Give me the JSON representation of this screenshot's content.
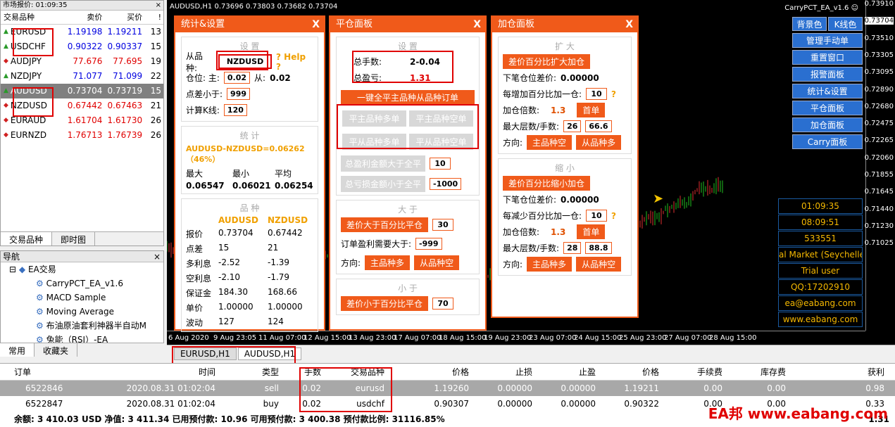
{
  "market": {
    "caption": "市场报价: 01:09:35",
    "close": "×",
    "headers": [
      "交易品种",
      "卖价",
      "买价",
      "!"
    ],
    "rows": [
      {
        "sym": "EURUSD",
        "bid": "1.19198",
        "ask": "1.19211",
        "sp": "13",
        "dir": "up",
        "bc": "blue",
        "ac": "blue"
      },
      {
        "sym": "USDCHF",
        "bid": "0.90322",
        "ask": "0.90337",
        "sp": "15",
        "dir": "up",
        "bc": "blue",
        "ac": "blue"
      },
      {
        "sym": "AUDJPY",
        "bid": "77.676",
        "ask": "77.695",
        "sp": "19",
        "dir": "dn",
        "bc": "red",
        "ac": "red"
      },
      {
        "sym": "NZDJPY",
        "bid": "71.077",
        "ask": "71.099",
        "sp": "22",
        "dir": "up",
        "bc": "blue",
        "ac": "blue"
      },
      {
        "sym": "AUDUSD",
        "bid": "0.73704",
        "ask": "0.73719",
        "sp": "15",
        "dir": "up",
        "bc": "red",
        "ac": "red",
        "sel": true
      },
      {
        "sym": "NZDUSD",
        "bid": "0.67442",
        "ask": "0.67463",
        "sp": "21",
        "dir": "dn",
        "bc": "red",
        "ac": "red"
      },
      {
        "sym": "EURAUD",
        "bid": "1.61704",
        "ask": "1.61730",
        "sp": "26",
        "dir": "dn",
        "bc": "red",
        "ac": "red"
      },
      {
        "sym": "EURNZD",
        "bid": "1.76713",
        "ask": "1.76739",
        "sp": "26",
        "dir": "dn",
        "bc": "red",
        "ac": "red"
      }
    ],
    "tabs": [
      "交易品种",
      "即时图"
    ]
  },
  "nav": {
    "caption": "导航",
    "close": "×",
    "items": [
      "EA交易",
      "CarryPCT_EA_v1.6",
      "MACD Sample",
      "Moving Average",
      "布油原油套利神器半自动M",
      "兔能（RSI）-EA"
    ],
    "tabs": [
      "常用",
      "收藏夹"
    ]
  },
  "chart": {
    "title": "AUDUSD,H1  0.73696 0.73803 0.73682 0.73704",
    "ea": "CarryPCT_EA_v1.6 ☺",
    "prices": [
      "0.73910",
      "0.73704",
      "0.73510",
      "0.73305",
      "0.73095",
      "0.72890",
      "0.72680",
      "0.72475",
      "0.72265",
      "0.72060",
      "0.71855",
      "0.71645",
      "0.71440",
      "0.71230",
      "0.71025"
    ],
    "times": [
      "6 Aug 2020",
      "9 Aug 23:05",
      "11 Aug 07:00",
      "12 Aug 15:00",
      "13 Aug 23:00",
      "17 Aug 07:00",
      "18 Aug 15:00",
      "19 Aug 23:00",
      "23 Aug 07:00",
      "24 Aug 15:00",
      "25 Aug 23:00",
      "27 Aug 07:00",
      "28 Aug 15:00"
    ],
    "btn_top": [
      "背景色",
      "K线色"
    ],
    "buttons": [
      "管理手动单",
      "重置窗口",
      "报警面板",
      "统计&设置",
      "平仓面板",
      "加仓面板",
      "Carry面板"
    ],
    "info": [
      "01:09:35",
      "08:09:51",
      "533551",
      "al Market (Seychelle",
      "Trial user",
      "QQ:17202910",
      "ea@eabang.com",
      "www.eabang.com"
    ]
  },
  "p1": {
    "title": "统计&设置",
    "x": "X",
    "sec1": "设  置",
    "from_sym_label": "从品种:",
    "from_sym": "NZDUSD",
    "help": "? Help ?",
    "pos_label": "仓位: 主:",
    "pos_main": "0.02",
    "pos_from_label": "从:",
    "pos_from": "0.02",
    "spread_label": "点差小于:",
    "spread": "999",
    "kline_label": "计算K线:",
    "kline": "120",
    "sec2": "统  计",
    "pair": "AUDUSD-NZDUSD=0.06262（46%）",
    "stat_h": [
      "最大",
      "最小",
      "平均"
    ],
    "stat_v": [
      "0.06547",
      "0.06021",
      "0.06254"
    ],
    "sec3": "品  种",
    "cols": [
      "",
      "AUDUSD",
      "NZDUSD"
    ],
    "rows": [
      [
        "报价",
        "0.73704",
        "0.67442"
      ],
      [
        "点差",
        "15",
        "21"
      ],
      [
        "多利息",
        "-2.52",
        "-1.39"
      ],
      [
        "空利息",
        "-2.10",
        "-1.79"
      ],
      [
        "保证金",
        "184.30",
        "168.66"
      ],
      [
        "单价",
        "1.00000",
        "1.00000"
      ],
      [
        "波动",
        "127",
        "124"
      ]
    ]
  },
  "p2": {
    "title": "平仓面板",
    "x": "X",
    "sec1": "设  置",
    "total_lots_label": "总手数:",
    "total_lots": "2-0.04",
    "total_pl_label": "总盈亏:",
    "total_pl": "1.31",
    "closeall": "一键全平主品种从品种订单",
    "b1": "平主品种多单",
    "b2": "平主品种空单",
    "b3": "平从品种多单",
    "b4": "平从品种空单",
    "g1": "总盈利金额大于全平",
    "g1v": "10",
    "g2": "总亏损金额小于全平",
    "g2v": "-1000",
    "sec2": "大  于",
    "big_btn": "差价大于百分比平仓",
    "big_v": "30",
    "profit_label": "订单盈利需要大于:",
    "profit_v": "-999",
    "dir_label": "方向:",
    "d1": "主品种多",
    "d2": "从品种空",
    "sec3": "小  于",
    "small_btn": "差价小于百分比平仓",
    "small_v": "70"
  },
  "p3": {
    "title": "加仓面板",
    "x": "X",
    "sec1": "扩  大",
    "expand_btn": "差价百分比扩大加仓",
    "next_label": "下笔仓位差价:",
    "next_v": "0.00000",
    "inc_label": "每增加百分比加一仓:",
    "inc_v": "10",
    "q": "?",
    "mult_label": "加仓倍数:",
    "mult_v": "1.3",
    "first": "首单",
    "max_label": "最大层数/手数:",
    "max_l": "26",
    "max_n": "66.6",
    "dir_label": "方向:",
    "d1": "主品种空",
    "d2": "从品种多",
    "sec2": "缩  小",
    "shrink_btn": "差价百分比缩小加仓",
    "next2_v": "0.00000",
    "dec_label": "每减少百分比加一仓:",
    "dec_v": "10",
    "mult2_v": "1.3",
    "max2_l": "28",
    "max2_n": "88.8",
    "d3": "主品种多",
    "d4": "从品种空"
  },
  "charttabs": [
    "EURUSD,H1",
    "AUDUSD,H1"
  ],
  "term": {
    "headers": [
      "订单",
      "时间",
      "类型",
      "手数",
      "交易品种",
      "价格",
      "止损",
      "止盈",
      "价格",
      "手续费",
      "库存费",
      "获利"
    ],
    "rows": [
      [
        "6522846",
        "2020.08.31 01:02:04",
        "sell",
        "0.02",
        "eurusd",
        "1.19260",
        "0.00000",
        "0.00000",
        "1.19211",
        "0.00",
        "0.00",
        "0.98"
      ],
      [
        "6522847",
        "2020.08.31 01:02:04",
        "buy",
        "0.02",
        "usdchf",
        "0.90307",
        "0.00000",
        "0.00000",
        "0.90322",
        "0.00",
        "0.00",
        "0.33"
      ]
    ],
    "balance": "余额: 3 410.03 USD  净值: 3 411.34  已用预付款: 10.96  可用预付款: 3 400.38  预付款比例: 31116.85%",
    "total": "1.31"
  },
  "watermark": "EA邦 www.eabang.com"
}
